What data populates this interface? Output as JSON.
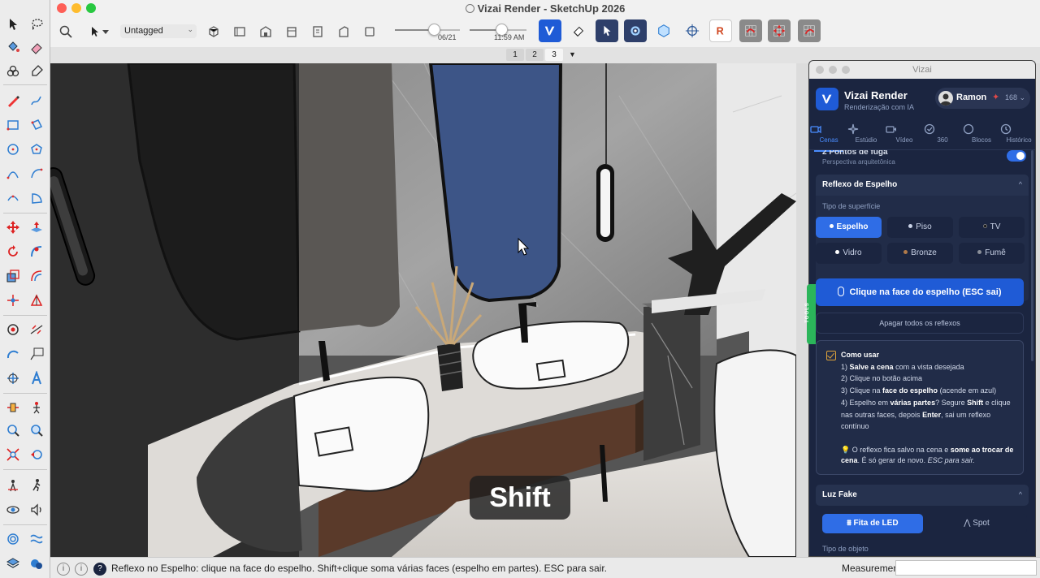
{
  "window": {
    "title": "Vizai Render - SketchUp 2026"
  },
  "toolbar": {
    "tag_select": "Untagged",
    "date_label": "06/21",
    "time_label": "11:59 AM",
    "date_fraction": 0.6,
    "time_fraction": 0.55
  },
  "scene_tabs": {
    "items": [
      "1",
      "2",
      "3"
    ],
    "active": "3",
    "menu_glyph": "▼"
  },
  "viewport": {
    "key_overlay": "Shift"
  },
  "statusbar": {
    "message": "Reflexo no Espelho: clique na face do espelho. Shift+clique soma várias faces (espelho em partes). ESC para sair.",
    "measurements_label": "Measurements",
    "measurements_value": ""
  },
  "vizai": {
    "window_title": "Vizai",
    "app_name": "Vizai Render",
    "app_subtitle": "Renderização com IA",
    "user_name": "Ramon",
    "credits": "168",
    "credits_chevron": "⌄",
    "tabs": [
      {
        "label": "Cenas",
        "icon": "camera-icon"
      },
      {
        "label": "Estúdio",
        "icon": "sparkle-icon"
      },
      {
        "label": "Vídeo",
        "icon": "video-icon"
      },
      {
        "label": "360",
        "icon": "check-badge-icon"
      },
      {
        "label": "Blocos",
        "icon": "circle-icon"
      },
      {
        "label": "Histórico",
        "icon": "history-icon"
      }
    ],
    "active_tab": "Cenas",
    "perspective": {
      "title": "2 Pontos de fuga",
      "subtitle": "Perspectiva arquitetônica",
      "enabled": true
    },
    "mirror": {
      "section_title": "Reflexo de Espelho",
      "chevron": "^",
      "surface_label": "Tipo de superfície",
      "surfaces": [
        {
          "label": "Espelho",
          "dot": "#ffffff"
        },
        {
          "label": "Piso",
          "dot": "#c9d2e6"
        },
        {
          "label": "TV",
          "dot": "#111111"
        },
        {
          "label": "Vidro",
          "dot": "#ffffff"
        },
        {
          "label": "Bronze",
          "dot": "#b07a4a"
        },
        {
          "label": "Fumê",
          "dot": "#8a8f99"
        }
      ],
      "active_surface": "Espelho",
      "click_button": "Clique na face do espelho (ESC sai)",
      "clear_button": "Apagar todos os reflexos"
    },
    "howto": {
      "title": "Como usar",
      "lines": [
        {
          "pre": "1) ",
          "bold": "Salve a cena",
          "post": " com a vista desejada"
        },
        {
          "pre": "2) Clique no botão acima",
          "bold": "",
          "post": ""
        },
        {
          "pre": "3) Clique na ",
          "bold": "face do espelho",
          "post": " (acende em azul)"
        },
        {
          "pre": "4) Espelho em ",
          "bold": "várias partes",
          "post": "? Segure "
        },
        {
          "pre": "nas outras faces, depois ",
          "bold": "Enter",
          "post": ", sai um reflexo"
        },
        {
          "pre": "contínuo",
          "bold": "",
          "post": ""
        }
      ],
      "line4_bold2": "Shift",
      "line4_post2": " e clique",
      "tip_pre": "O reflexo fica salvo na cena e ",
      "tip_bold": "some ao trocar de cena",
      "tip_post": ". É só gerar de novo. ",
      "tip_italic": "ESC para sair."
    },
    "fake_light": {
      "section_title": "Luz Fake",
      "chevron": "^",
      "options": [
        "Fita de LED",
        "Spot"
      ],
      "active": "Fita de LED",
      "object_type_label": "Tipo de objeto"
    },
    "tools_tab_label": "TOOLS"
  },
  "colors": {
    "accent": "#2f6de6",
    "panel_bg": "#1b2540",
    "mirror_blue": "#3d5587",
    "tools_green": "#2bb55a"
  }
}
